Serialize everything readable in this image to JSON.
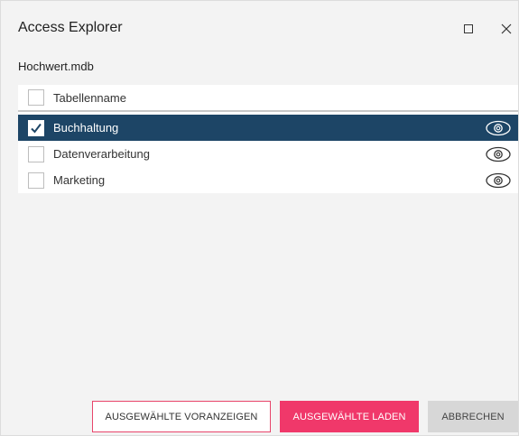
{
  "window": {
    "title": "Access Explorer",
    "file_name": "Hochwert.mdb"
  },
  "table_list": {
    "header_label": "Tabellenname",
    "header_checked": false,
    "rows": [
      {
        "label": "Buchhaltung",
        "checked": true,
        "selected": true,
        "action_icon": "eye-icon"
      },
      {
        "label": "Datenverarbeitung",
        "checked": false,
        "selected": false,
        "action_icon": "eye-icon"
      },
      {
        "label": "Marketing",
        "checked": false,
        "selected": false,
        "action_icon": "eye-icon"
      }
    ]
  },
  "buttons": {
    "preview_label": "AUSGEWÄHLTE VORANZEIGEN",
    "load_label": "AUSGEWÄHLTE LADEN",
    "cancel_label": "ABBRECHEN"
  },
  "icons": {
    "maximize": "maximize-icon",
    "close": "close-icon",
    "preview": "eye-icon",
    "checkmark": "checkmark-icon"
  },
  "colors": {
    "selected_row": "#1d4566",
    "accent": "#f0386a",
    "accent_border": "#e8456b",
    "secondary_button": "#d7d7d7"
  }
}
